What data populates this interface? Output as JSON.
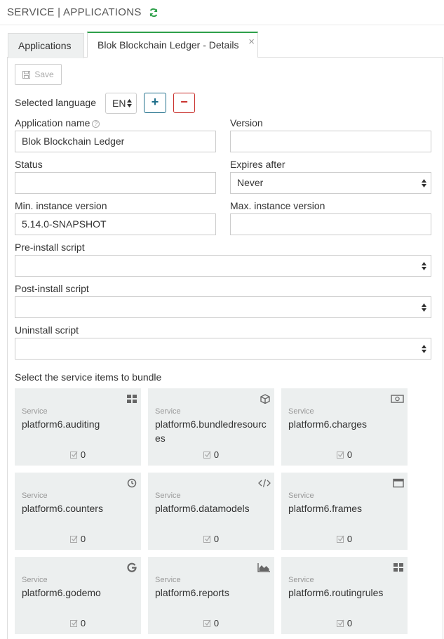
{
  "header": {
    "title": "SERVICE | APPLICATIONS"
  },
  "tabs": [
    {
      "label": "Applications"
    },
    {
      "label": "Blok Blockchain Ledger - Details",
      "close": "×"
    }
  ],
  "toolbar": {
    "save_label": "Save"
  },
  "language": {
    "label": "Selected language",
    "value": "EN",
    "add": "+",
    "remove": "−"
  },
  "form": {
    "app_name_label": "Application name",
    "app_name_value": "Blok Blockchain Ledger",
    "version_label": "Version",
    "version_value": "",
    "status_label": "Status",
    "status_value": "",
    "expires_label": "Expires after",
    "expires_value": "Never",
    "min_version_label": "Min. instance version",
    "min_version_value": "5.14.0-SNAPSHOT",
    "max_version_label": "Max. instance version",
    "max_version_value": "",
    "preinstall_label": "Pre-install script",
    "postinstall_label": "Post-install script",
    "uninstall_label": "Uninstall script"
  },
  "bundle": {
    "title": "Select the service items to bundle",
    "items": [
      {
        "type": "Service",
        "name": "platform6.auditing",
        "count": "0",
        "icon": "grid-icon"
      },
      {
        "type": "Service",
        "name": "platform6.bundledresources",
        "count": "0",
        "icon": "cube-icon"
      },
      {
        "type": "Service",
        "name": "platform6.charges",
        "count": "0",
        "icon": "money-icon"
      },
      {
        "type": "Service",
        "name": "platform6.counters",
        "count": "0",
        "icon": "clock-icon"
      },
      {
        "type": "Service",
        "name": "platform6.datamodels",
        "count": "0",
        "icon": "code-icon"
      },
      {
        "type": "Service",
        "name": "platform6.frames",
        "count": "0",
        "icon": "window-icon"
      },
      {
        "type": "Service",
        "name": "platform6.godemo",
        "count": "0",
        "icon": "google-icon"
      },
      {
        "type": "Service",
        "name": "platform6.reports",
        "count": "0",
        "icon": "area-chart-icon"
      },
      {
        "type": "Service",
        "name": "platform6.routingrules",
        "count": "0",
        "icon": "grid-icon"
      }
    ]
  },
  "colors": {
    "accent": "#2ea04a",
    "add": "#1f6f8b",
    "remove": "#c9302c",
    "card_bg": "#ecefef"
  }
}
